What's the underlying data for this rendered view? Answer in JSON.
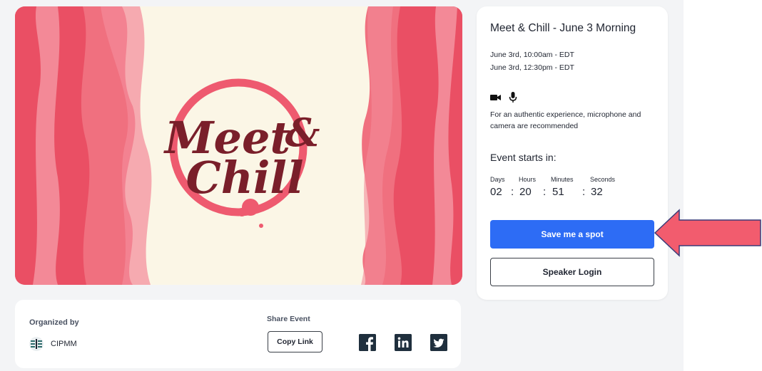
{
  "event": {
    "title": "Meet & Chill - June 3 Morning",
    "start": "June 3rd, 10:00am - EDT",
    "end": "June 3rd, 12:30pm - EDT",
    "media_note": "For an authentic experience, microphone and camera are recommended",
    "starts_in_label": "Event starts in:"
  },
  "banner": {
    "line1": "Meet",
    "amp": "&",
    "line2": "Chill"
  },
  "countdown": {
    "days_label": "Days",
    "hours_label": "Hours",
    "minutes_label": "Minutes",
    "seconds_label": "Seconds",
    "days": "02",
    "hours": "20",
    "minutes": "51",
    "seconds": "32",
    "separator": ":"
  },
  "buttons": {
    "save_spot": "Save me a spot",
    "speaker_login": "Speaker Login",
    "copy_link": "Copy Link"
  },
  "organizer": {
    "label": "Organized by",
    "name": "CIPMM"
  },
  "share": {
    "label": "Share Event",
    "icons": [
      "facebook-icon",
      "linkedin-icon",
      "twitter-icon"
    ]
  },
  "colors": {
    "primary": "#2d6cf5",
    "arrow": "#f25c6e",
    "banner_wine": "#7a1f2a",
    "banner_pink": "#ee5a6f"
  }
}
